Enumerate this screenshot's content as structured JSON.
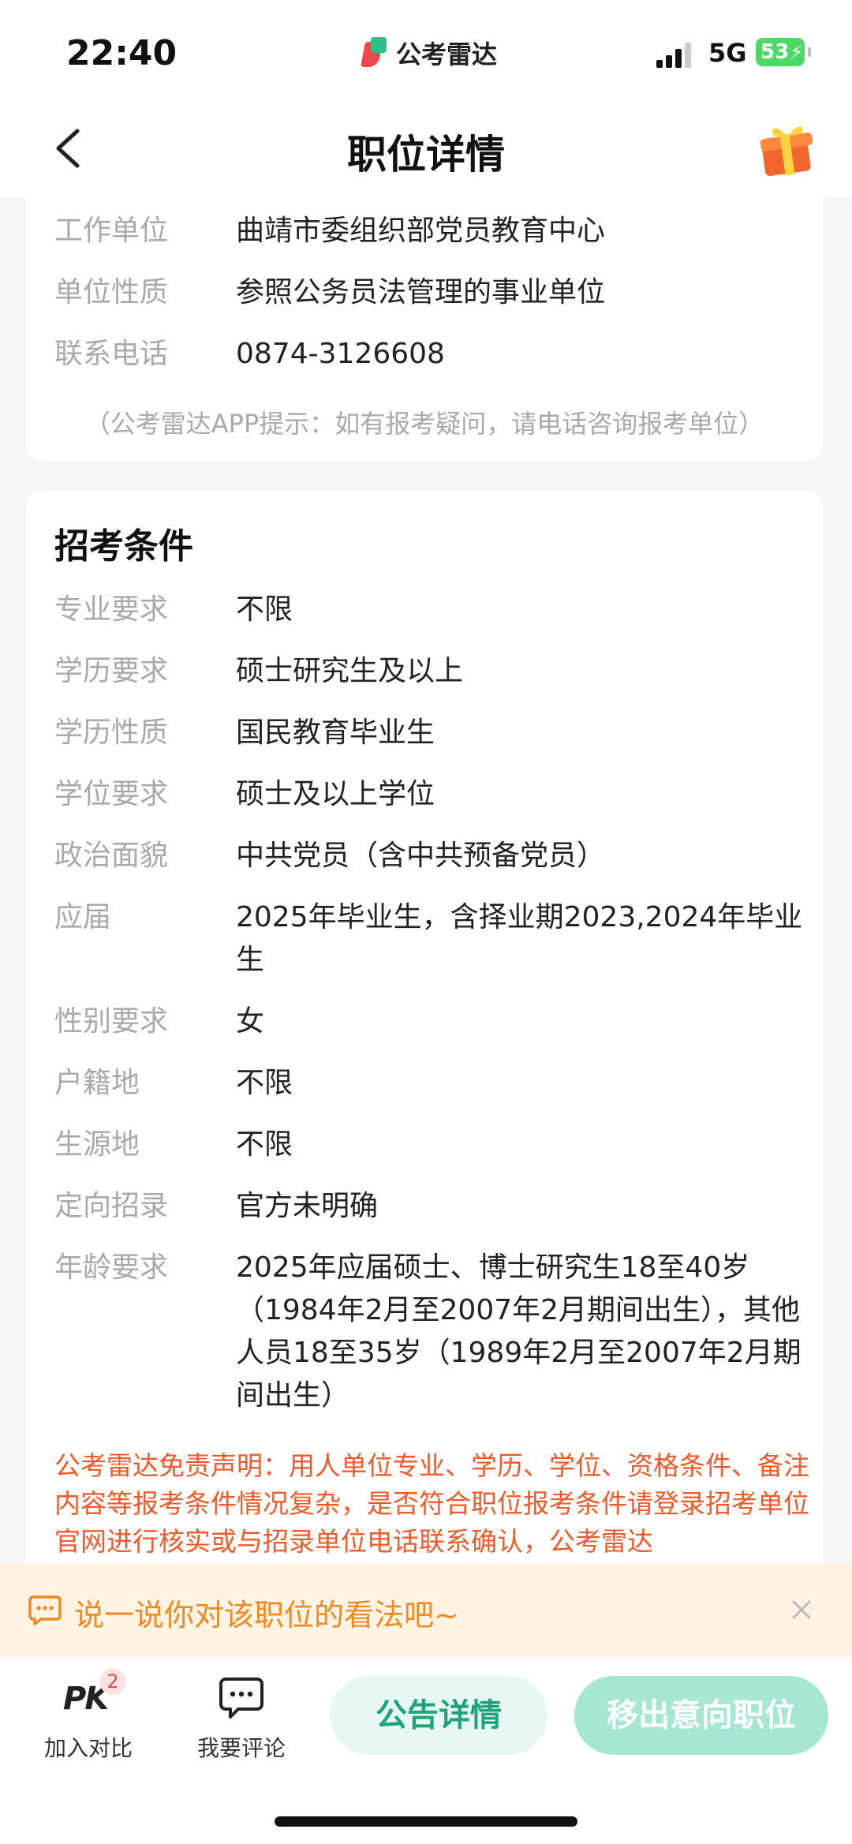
{
  "status_bar": {
    "time": "22:40",
    "brand": "公考雷达",
    "network": "5G",
    "battery": "53"
  },
  "header": {
    "title": "职位详情"
  },
  "unit_info": {
    "rows": [
      {
        "label": "工作单位",
        "value": "曲靖市委组织部党员教育中心"
      },
      {
        "label": "单位性质",
        "value": "参照公务员法管理的事业单位"
      },
      {
        "label": "联系电话",
        "value": "0874-3126608"
      }
    ],
    "hint": "（公考雷达APP提示：如有报考疑问，请电话咨询报考单位）"
  },
  "conditions": {
    "title": "招考条件",
    "rows": [
      {
        "label": "专业要求",
        "value": "不限"
      },
      {
        "label": "学历要求",
        "value": "硕士研究生及以上"
      },
      {
        "label": "学历性质",
        "value": "国民教育毕业生"
      },
      {
        "label": "学位要求",
        "value": "硕士及以上学位"
      },
      {
        "label": "政治面貌",
        "value": "中共党员（含中共预备党员）"
      },
      {
        "label": "应届",
        "value": "2025年毕业生，含择业期2023,2024年毕业生"
      },
      {
        "label": "性别要求",
        "value": "女"
      },
      {
        "label": "户籍地",
        "value": "不限"
      },
      {
        "label": "生源地",
        "value": "不限"
      },
      {
        "label": "定向招录",
        "value": "官方未明确"
      },
      {
        "label": "年龄要求",
        "value": "2025年应届硕士、博士研究生18至40岁（1984年2月至2007年2月期间出生），其他人员18至35岁（1989年2月至2007年2月期间出生）"
      }
    ],
    "disclaimer": "公考雷达免责声明：用人单位专业、学历、学位、资格条件、备注内容等报考条件情况复杂，是否符合职位报考条件请登录招考单位官网进行核实或与招录单位电话联系确认，公考雷达"
  },
  "comment_prompt": "说一说你对该职位的看法吧~",
  "bottom_bar": {
    "compare_icon_text": "PK",
    "compare_badge": "2",
    "compare_label": "加入对比",
    "comment_label": "我要评论",
    "notice_button": "公告详情",
    "remove_button": "移出意向职位"
  },
  "colors": {
    "accent": "#1fa37c",
    "warning": "#f05a2a",
    "prompt": "#f08a1e"
  }
}
